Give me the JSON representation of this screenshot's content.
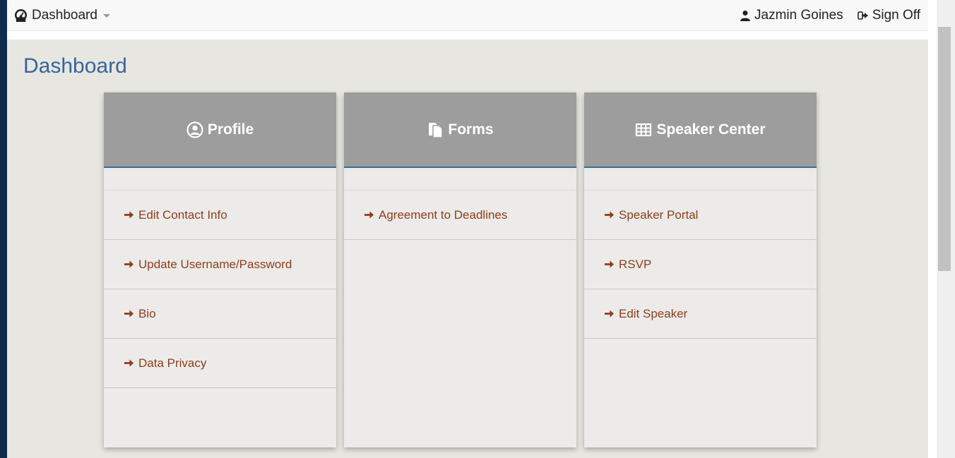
{
  "navbar": {
    "brand_label": "Dashboard",
    "user_name": "Jazmin Goines",
    "signoff_label": "Sign Off"
  },
  "page": {
    "title": "Dashboard"
  },
  "cards": [
    {
      "title": "Profile",
      "icon": "user-circle-icon",
      "items": [
        {
          "label": "Edit Contact Info"
        },
        {
          "label": "Update Username/Password"
        },
        {
          "label": "Bio"
        },
        {
          "label": "Data Privacy"
        }
      ]
    },
    {
      "title": "Forms",
      "icon": "copy-icon",
      "items": [
        {
          "label": "Agreement to Deadlines"
        }
      ]
    },
    {
      "title": "Speaker Center",
      "icon": "table-icon",
      "items": [
        {
          "label": "Speaker Portal"
        },
        {
          "label": "RSVP"
        },
        {
          "label": "Edit Speaker"
        }
      ]
    }
  ],
  "colors": {
    "title": "#34659a",
    "link": "#8e3d18",
    "card_header": "#9d9d9d",
    "content_bg": "#e7e6e1"
  }
}
